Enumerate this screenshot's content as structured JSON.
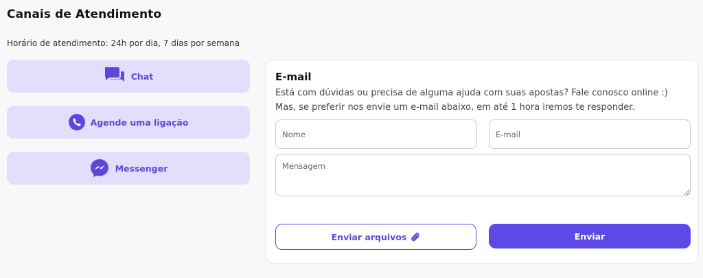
{
  "header": {
    "title": "Canais de Atendimento",
    "subtitle": "Horário de atendimento: 24h por dia, 7 dias por semana"
  },
  "channels": [
    {
      "label": "Chat",
      "icon": "chat-bubbles-icon"
    },
    {
      "label": "Agende uma ligação",
      "icon": "phone-icon"
    },
    {
      "label": "Messenger",
      "icon": "messenger-icon"
    }
  ],
  "email_form": {
    "title": "E-mail",
    "description": "Está com dúvidas ou precisa de alguma ajuda com suas apostas? Fale conosco online :) Mas, se preferir nos envie um e-mail abaixo, em até 1 hora iremos te responder.",
    "name_placeholder": "Nome",
    "email_placeholder": "E-mail",
    "message_placeholder": "Mensagem",
    "attach_label": "Enviar arquivos",
    "attach_icon": "paperclip-icon",
    "send_label": "Enviar"
  },
  "colors": {
    "accent": "#5c49e6",
    "channel_bg": "#e3defb",
    "page_bg": "#f8f8f8"
  }
}
